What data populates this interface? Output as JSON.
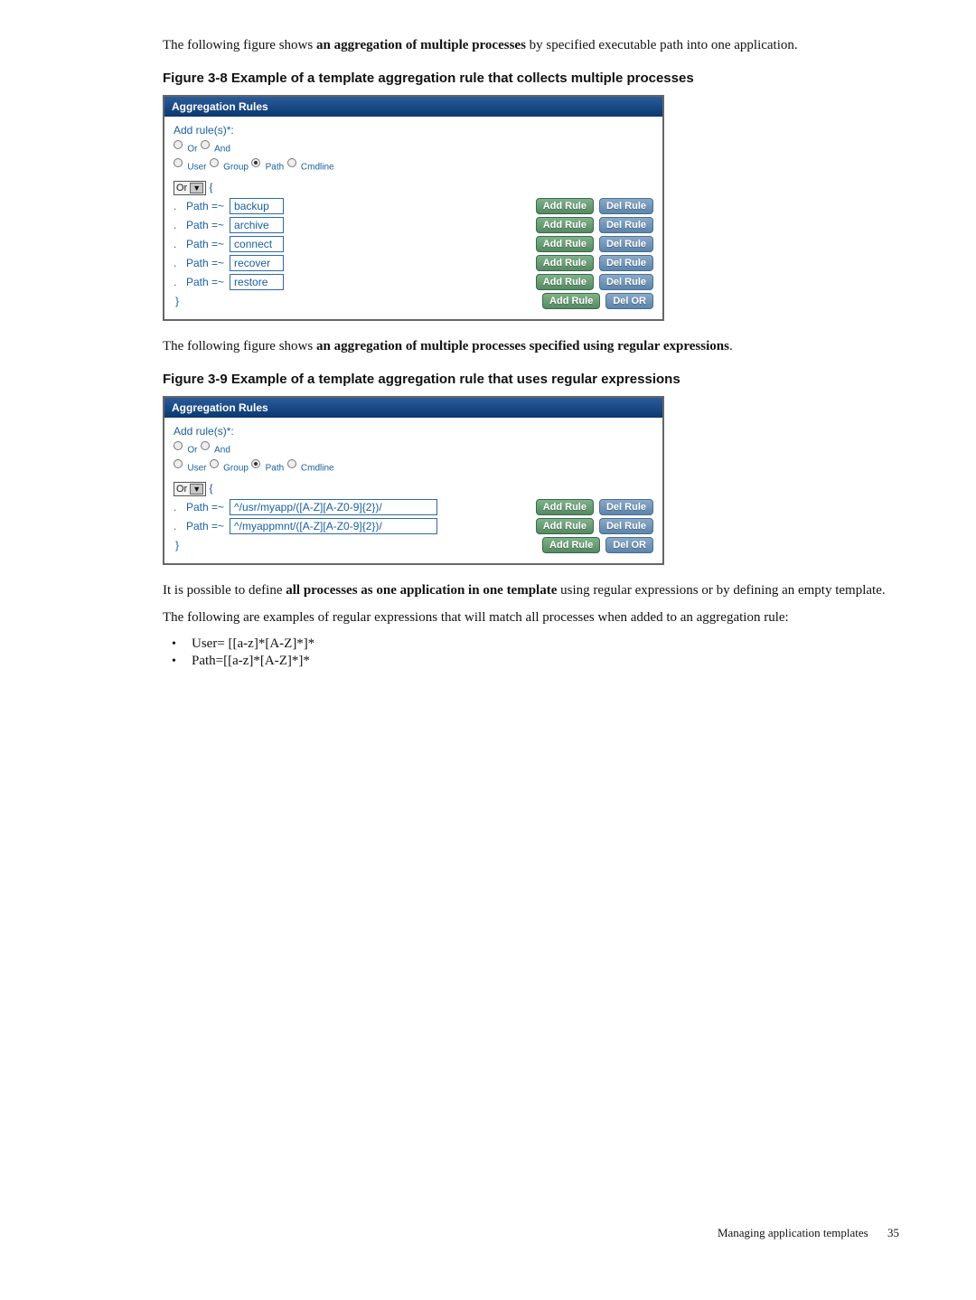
{
  "intro1_before": "The following figure shows ",
  "intro1_bold": "an aggregation of multiple processes",
  "intro1_after": " by specified executable path into one application.",
  "fig38_caption": "Figure 3-8 Example of a template aggregation rule that collects multiple processes",
  "panel_header": "Aggregation Rules",
  "add_rules_label": "Add rule(s)*:",
  "logic": {
    "or": "Or",
    "and": "And"
  },
  "scope": {
    "user": "User",
    "group": "Group",
    "path": "Path",
    "cmdline": "Cmdline"
  },
  "select_value": "Or",
  "brace_open": "{",
  "brace_close": "}",
  "path_eq": "Path =~",
  "fig38_rules": [
    {
      "value": "backup"
    },
    {
      "value": "archive"
    },
    {
      "value": "connect"
    },
    {
      "value": "recover"
    },
    {
      "value": "restore"
    }
  ],
  "btn_add": "Add Rule",
  "btn_del": "Del Rule",
  "btn_delor": "Del OR",
  "intro2_before": "The following figure shows ",
  "intro2_bold": "an aggregation of multiple processes specified using regular expressions",
  "intro2_after": ".",
  "fig39_caption": "Figure 3-9 Example of a template aggregation rule that uses regular expressions",
  "fig39_rules": [
    {
      "value": "^/usr/myapp/([A-Z][A-Z0-9]{2})/"
    },
    {
      "value": "^/myappmnt/([A-Z][A-Z0-9]{2})/"
    }
  ],
  "para3_before": "It is possible to define ",
  "para3_bold": "all processes as one application in one template",
  "para3_after": " using regular expressions or by defining an empty template.",
  "para4": "The following are examples of regular expressions that will match all processes when added to an aggregation rule:",
  "bullets": [
    "User= [[a-z]*[A-Z]*]*",
    "Path=[[a-z]*[A-Z]*]*"
  ],
  "footer_text": "Managing application templates",
  "footer_page": "35"
}
